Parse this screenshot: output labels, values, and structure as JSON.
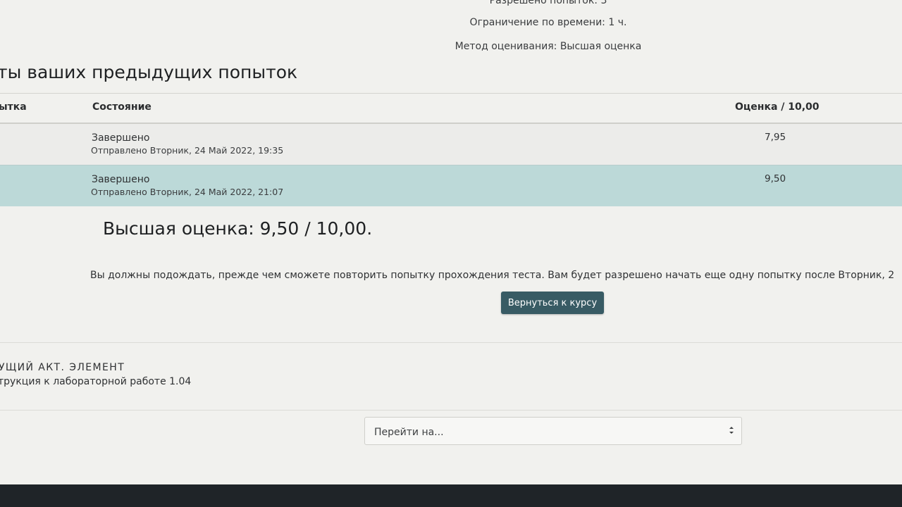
{
  "quiz_info": {
    "attempts_allowed_cut": "Разрешено попыток: 3",
    "time_limit": "Ограничение по времени: 1 ч.",
    "grading_method": "Метод оценивания: Высшая оценка"
  },
  "summary": {
    "heading": "ты ваших предыдущих попыток",
    "columns": {
      "attempt": "ытка",
      "state": "Состояние",
      "grade": "Оценка / 10,00"
    },
    "rows": [
      {
        "state": "Завершено",
        "submitted": "Отправлено Вторник, 24 Май 2022, 19:35",
        "grade": "7,95"
      },
      {
        "state": "Завершено",
        "submitted": "Отправлено Вторник, 24 Май 2022, 21:07",
        "grade": "9,50"
      }
    ]
  },
  "best_grade": "Высшая оценка: 9,50 / 10,00.",
  "wait_message": "Вы должны подождать, прежде чем сможете повторить попытку прохождения теста. Вам будет разрешено начать еще одну попытку после Вторник, 2",
  "back_button": "Вернуться к курсу",
  "previous_activity": {
    "label": "УЩИЙ АКТ. ЭЛЕМЕНТ",
    "link": "трукция к лабораторной работе 1.04"
  },
  "jump_to": {
    "placeholder": "Перейти на..."
  },
  "colors": {
    "highlight_row": "#bcd9d8",
    "button": "#385b64"
  },
  "icons": [
    "select-caret-icon"
  ]
}
